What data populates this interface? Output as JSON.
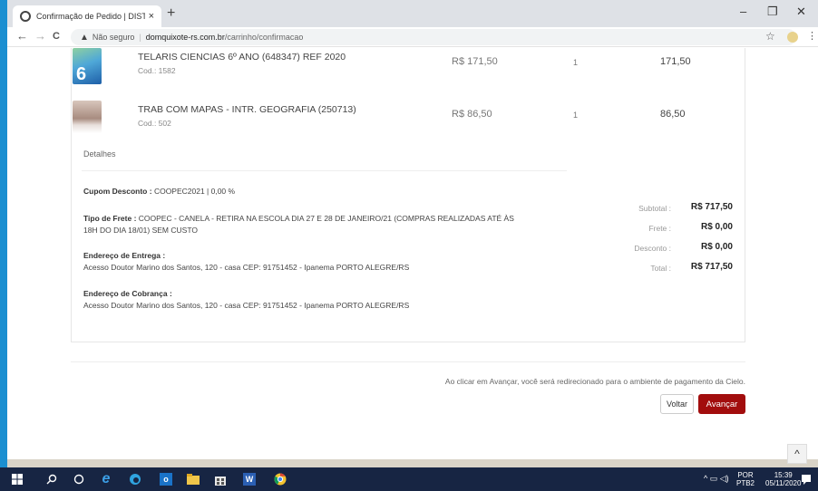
{
  "browser": {
    "tab_title": "Confirmação de Pedido | DISTRIB",
    "tab_close": "×",
    "new_tab": "+",
    "minimize": "–",
    "maximize": "❐",
    "close": "✕",
    "back": "←",
    "forward": "→",
    "reload": "C",
    "security_label": "Não seguro",
    "url_host": "domquixote-rs.com.br",
    "url_path": "/carrinho/confirmacao",
    "bookmark_icon": "star-icon",
    "menu": "⋮"
  },
  "cart": {
    "items": [
      {
        "name": "TELARIS CIENCIAS 6º ANO (648347) REF 2020",
        "code": "Cod.: 1582",
        "price": "R$ 171,50",
        "qty": "1",
        "total": "171,50",
        "thumb_color": "#2a7ab8"
      },
      {
        "name": "TRAB COM MAPAS - INTR. GEOGRAFIA (250713)",
        "code": "Cod.: 502",
        "price": "R$ 86,50",
        "qty": "1",
        "total": "86,50",
        "thumb_color": "#b89a8a"
      }
    ],
    "details_label": "Detalhes"
  },
  "order": {
    "coupon_label": "Cupom Desconto :",
    "coupon_value": "COOPEC2021 | 0,00 %",
    "shipping_label": "Tipo de Frete :",
    "shipping_value": "COOPEC - CANELA - RETIRA NA ESCOLA DIA 27 E 28 DE JANEIRO/21 (COMPRAS REALIZADAS ATÉ ÀS",
    "shipping_value_2": "18H DO DIA 18/01) SEM CUSTO",
    "delivery_label": "Endereço de Entrega :",
    "delivery_value": "Acesso Doutor Marino dos Santos, 120 - casa CEP: 91751452 - Ipanema PORTO ALEGRE/RS",
    "billing_label": "Endereço de Cobrança :",
    "billing_value": "Acesso Doutor Marino dos Santos, 120 - casa CEP: 91751452 - Ipanema PORTO ALEGRE/RS"
  },
  "summary": {
    "subtotal_label": "Subtotal :",
    "subtotal_value": "R$ 717,50",
    "frete_label": "Frete :",
    "frete_value": "R$ 0,00",
    "desconto_label": "Desconto :",
    "desconto_value": "R$ 0,00",
    "total_label": "Total :",
    "total_value": "R$ 717,50"
  },
  "footer": {
    "notice": "Ao clicar em Avançar, você será redirecionado para o ambiente de pagamento da Cielo.",
    "voltar": "Voltar",
    "avancar": "Avançar",
    "avancar_color": "#a20d0d",
    "scroll_top": "^"
  },
  "taskbar": {
    "lang_1": "POR",
    "lang_2": "PTB2",
    "time": "15:39",
    "date": "05/11/2020",
    "apps": [
      "windows-start-icon",
      "search-icon",
      "cortana-icon",
      "ie-icon",
      "edge-icon",
      "outlook-icon",
      "file-explorer-icon",
      "store-icon",
      "word-icon",
      "chrome-icon"
    ]
  }
}
